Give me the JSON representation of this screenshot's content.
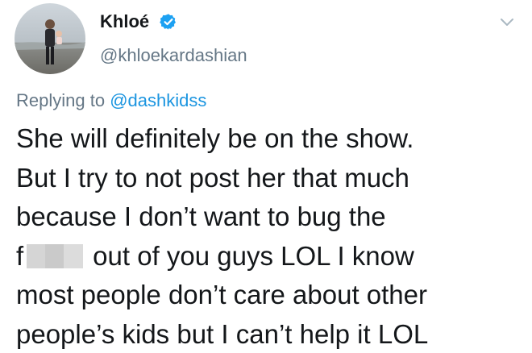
{
  "user": {
    "display_name": "Khloé",
    "handle": "@khloekardashian",
    "verified": true
  },
  "reply": {
    "prefix": "Replying to",
    "mention": "@dashkidss"
  },
  "tweet": {
    "lines": [
      "She will definitely be on the show.",
      "But I try to not post her that much",
      "because I don’t want to bug the"
    ],
    "censored_prefix": "f",
    "censored_suffix": "out of you guys LOL I know",
    "lines_after": [
      "most people don’t care about other",
      "people’s kids but I can’t help it LOL"
    ]
  },
  "icons": {
    "verified": "verified-badge-icon",
    "caret": "chevron-down-icon"
  },
  "colors": {
    "text": "#14171a",
    "secondary": "#657786",
    "link": "#1b95e0",
    "verified": "#1da1f2"
  }
}
